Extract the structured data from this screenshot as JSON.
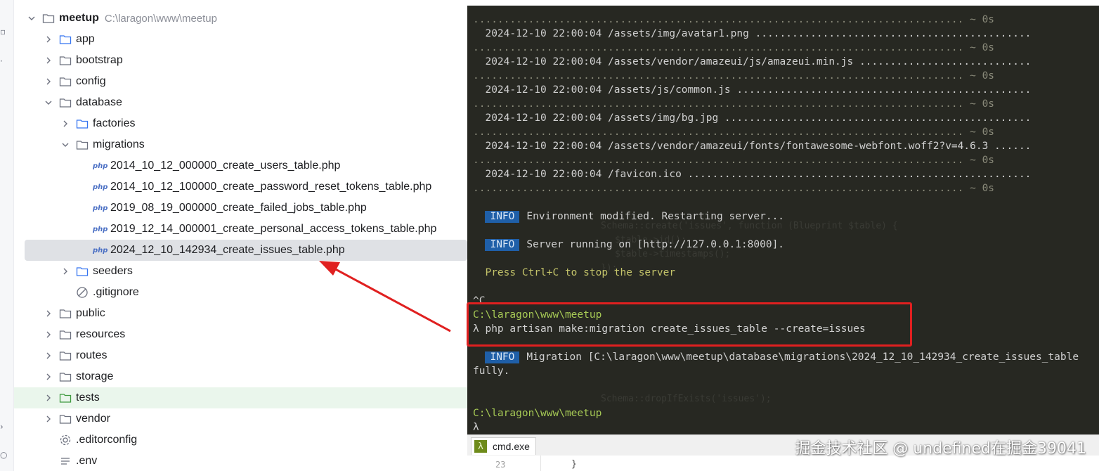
{
  "tree": {
    "root": {
      "label": "meetup",
      "path": "C:\\laragon\\www\\meetup"
    },
    "items": [
      {
        "label": "app"
      },
      {
        "label": "bootstrap"
      },
      {
        "label": "config"
      },
      {
        "label": "database"
      },
      {
        "label": "factories"
      },
      {
        "label": "migrations"
      },
      {
        "label": "2014_10_12_000000_create_users_table.php"
      },
      {
        "label": "2014_10_12_100000_create_password_reset_tokens_table.php"
      },
      {
        "label": "2019_08_19_000000_create_failed_jobs_table.php"
      },
      {
        "label": "2019_12_14_000001_create_personal_access_tokens_table.php"
      },
      {
        "label": "2024_12_10_142934_create_issues_table.php"
      },
      {
        "label": "seeders"
      },
      {
        "label": ".gitignore"
      },
      {
        "label": "public"
      },
      {
        "label": "resources"
      },
      {
        "label": "routes"
      },
      {
        "label": "storage"
      },
      {
        "label": "tests"
      },
      {
        "label": "vendor"
      },
      {
        "label": ".editorconfig"
      },
      {
        "label": ".env"
      }
    ],
    "php_badge": "php"
  },
  "terminal": {
    "tab_label": "cmd.exe",
    "tab_icon": "λ",
    "line_number": "23",
    "brace": "}",
    "lines": {
      "l0": "................................................................................ ~ 0s",
      "l1": "  2024-12-10 22:00:04 /assets/img/avatar1.png .............................................",
      "l2": "................................................................................ ~ 0s",
      "l3": "  2024-12-10 22:00:04 /assets/vendor/amazeui/js/amazeui.min.js ............................",
      "l4": "................................................................................ ~ 0s",
      "l5": "  2024-12-10 22:00:04 /assets/js/common.js ................................................",
      "l6": "................................................................................ ~ 0s",
      "l7": "  2024-12-10 22:00:04 /assets/img/bg.jpg ..................................................",
      "l8": "................................................................................ ~ 0s",
      "l9": "  2024-12-10 22:00:04 /assets/vendor/amazeui/fonts/fontawesome-webfont.woff2?v=4.6.3 ......",
      "l10": "................................................................................ ~ 0s",
      "l11": "  2024-12-10 22:00:04 /favicon.ico ........................................................",
      "l12": "................................................................................ ~ 0s",
      "info_badge": "INFO",
      "info1": "Environment modified. Restarting server...",
      "info2": "Server running on [http://127.0.0.1:8000].",
      "press": "  Press Ctrl+C to stop the server",
      "ctrl_c": "^C",
      "prompt_path": "C:\\laragon\\www\\meetup",
      "command": "λ php artisan make:migration create_issues_table --create=issues",
      "info3": "Migration [C:\\laragon\\www\\meetup\\database\\migrations\\2024_12_10_142934_create_issues_table",
      "fully": "fully.",
      "prompt_path2": "C:\\laragon\\www\\meetup",
      "lambda": "λ"
    }
  },
  "watermark": "掘金技术社区 @ undefined在掘金39041",
  "colors": {
    "terminal_bg": "#272822",
    "info_badge_bg": "#1f5fa8",
    "prompt_green": "#a6c955",
    "annotation_red": "#e02020",
    "selected_row": "#dfe1e5",
    "tests_row": "#eaf6ec"
  }
}
